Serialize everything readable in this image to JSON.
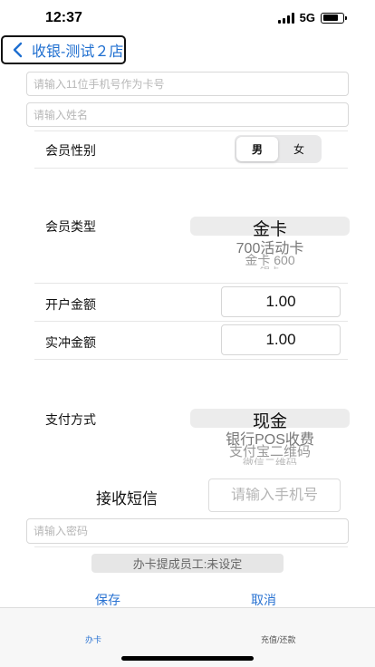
{
  "status_bar": {
    "time": "12:37",
    "network": "5G",
    "icons": [
      "signal-icon",
      "battery-icon"
    ]
  },
  "nav": {
    "back_icon": "chevron-left-icon",
    "title": "收银-测试２店"
  },
  "form": {
    "card_phone_placeholder": "请输入11位手机号作为卡号",
    "name_placeholder": "请输入姓名",
    "gender": {
      "label": "会员性别",
      "options": [
        "男",
        "女"
      ],
      "selected": "男"
    },
    "member_type": {
      "label": "会员类型",
      "selected": "金卡",
      "options_below": [
        "700活动卡",
        "金卡 600",
        "银卡"
      ]
    },
    "opening_amount": {
      "label": "开户金额",
      "value": "1.00"
    },
    "actual_charge": {
      "label": "实冲金额",
      "value": "1.00"
    },
    "payment": {
      "label": "支付方式",
      "selected": "现金",
      "options_below": [
        "银行POS收费",
        "支付宝二维码",
        "微信二维码"
      ]
    },
    "sms": {
      "label": "接收短信",
      "placeholder": "请输入手机号"
    },
    "password_placeholder": "请输入密码",
    "staff_button": "办卡提成员工:未设定"
  },
  "actions": {
    "save": "保存",
    "cancel": "取消"
  },
  "tabbar": {
    "tabs": [
      {
        "label": "办卡",
        "active": true
      },
      {
        "label": "充值/还款",
        "active": false
      }
    ]
  },
  "colors": {
    "accent": "#2a73d2",
    "placeholder": "#b7b7b7",
    "border": "#d8d8d8"
  }
}
